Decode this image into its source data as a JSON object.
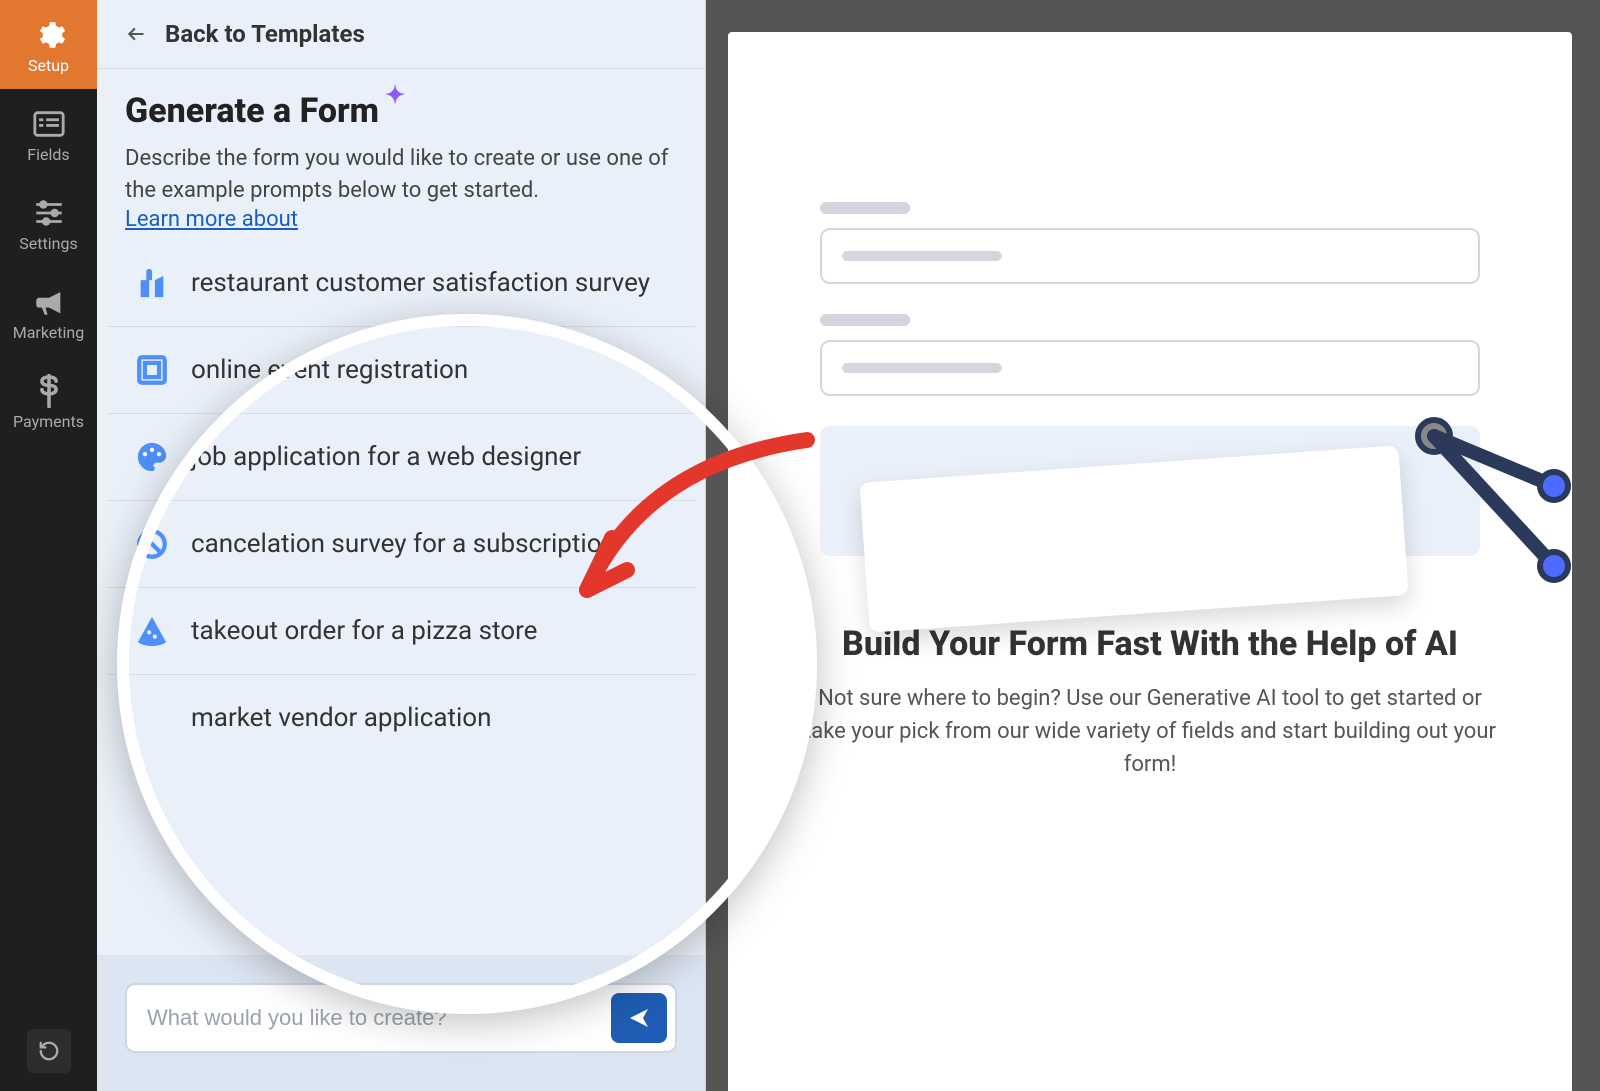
{
  "rail": {
    "items": [
      {
        "label": "Setup",
        "icon": "gear-icon",
        "active": true
      },
      {
        "label": "Fields",
        "icon": "list-icon",
        "active": false
      },
      {
        "label": "Settings",
        "icon": "sliders-icon",
        "active": false
      },
      {
        "label": "Marketing",
        "icon": "bullhorn-icon",
        "active": false
      },
      {
        "label": "Payments",
        "icon": "dollar-icon",
        "active": false
      }
    ],
    "history_button": "Revisions"
  },
  "panel": {
    "back_label": "Back to Templates",
    "title": "Generate a Form",
    "description": "Describe the form you would like to create or use one of the example prompts below to get started.",
    "learn_more": "Learn more about",
    "prompts": [
      {
        "icon": "food-icon",
        "text": "restaurant customer satisfaction survey"
      },
      {
        "icon": "ticket-icon",
        "text": "online event registration"
      },
      {
        "icon": "palette-icon",
        "text": "job application for a web designer"
      },
      {
        "icon": "cancel-icon",
        "text": "cancelation survey for a subscription"
      },
      {
        "icon": "pizza-icon",
        "text": "takeout order for a pizza store"
      },
      {
        "icon": "",
        "text": "market vendor application"
      }
    ],
    "input_placeholder": "What would you like to create?",
    "send_label": "Send"
  },
  "canvas": {
    "heading": "Build Your Form Fast With the Help of AI",
    "subheading": "Not sure where to begin? Use our Generative AI tool to get started or take your pick from our wide variety of fields and start building out your form!"
  },
  "colors": {
    "accent": "#e27730",
    "link": "#1a5fbf",
    "prompt_icon": "#4f8ff9",
    "send": "#1e5db3"
  }
}
